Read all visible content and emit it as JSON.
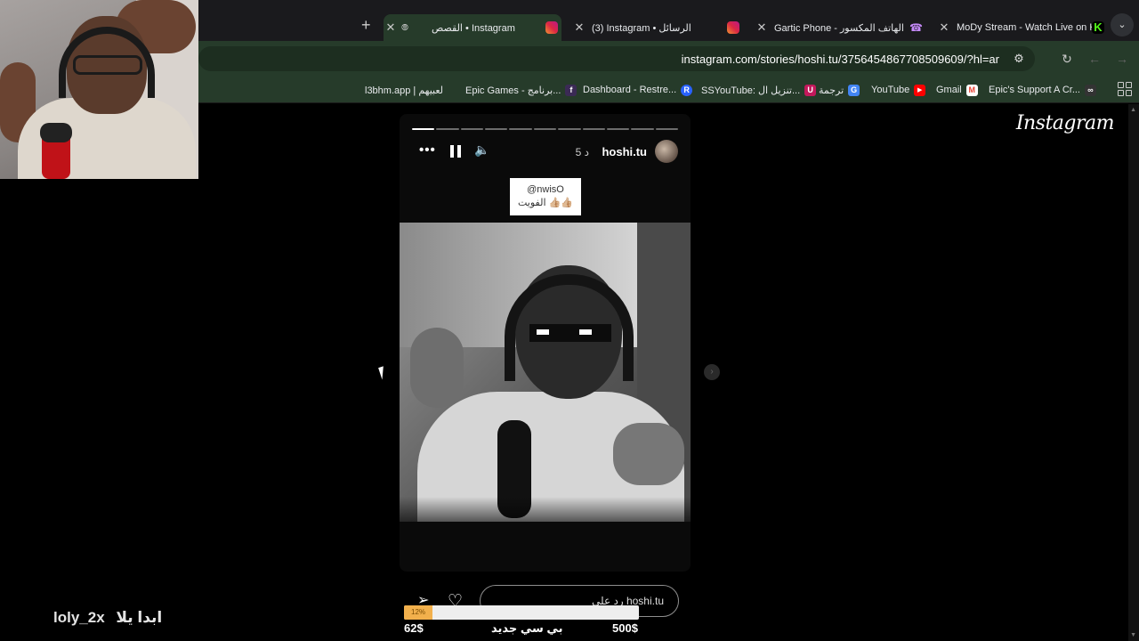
{
  "browser": {
    "tabs": [
      {
        "label": "MoDy Stream - Watch Live on Kick",
        "icon": "kick-icon"
      },
      {
        "label": "Gartic Phone - الهاتف المكسور",
        "icon": "phone-icon"
      },
      {
        "label": "(3) Instagram • الرسائل",
        "icon": "instagram-icon"
      },
      {
        "label": "القصص • Instagram",
        "icon": "instagram-icon"
      }
    ],
    "new_tab": "+",
    "url": "instagram.com/stories/hoshi.tu/3756454867708509609/?hl=ar",
    "bookmarks": [
      {
        "label": "Epic's Support A Cr...",
        "icon": "∞"
      },
      {
        "label": "Gmail",
        "icon": "M"
      },
      {
        "label": "YouTube",
        "icon": "▶"
      },
      {
        "label": "ترجمة",
        "icon": "G"
      },
      {
        "label": "SSYouTube: تنزيل ال...",
        "icon": "U"
      },
      {
        "label": "Dashboard - Restre...",
        "icon": "R"
      },
      {
        "label": "Epic Games - برنامج...",
        "icon": "f"
      },
      {
        "label": "l3bhm.app | لعبيهم",
        "icon": ""
      }
    ]
  },
  "instagram": {
    "logo": "Instagram",
    "story": {
      "username": "hoshi.tu",
      "time": "5 د",
      "mention_line1": "@nwisO",
      "mention_line2": "الفويت 👍🏼👍🏼",
      "reply_placeholder": "رد على hoshi.tu",
      "segments_total": 11,
      "segments_done": 1
    }
  },
  "overlay": {
    "chat_user": "loly_2x",
    "chat_message": "ابدا يلا",
    "goal_title": "بي سي جديد",
    "goal_current": "62$",
    "goal_target": "500$",
    "goal_percent_label": "12%",
    "goal_percent": 12
  }
}
